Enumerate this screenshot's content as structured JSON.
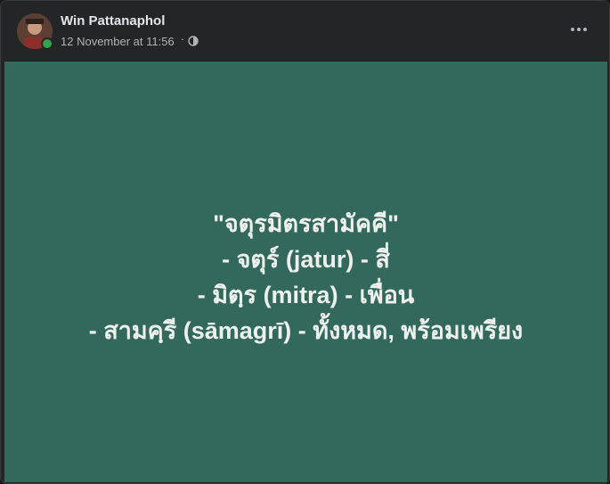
{
  "post": {
    "author": "Win Pattanaphol",
    "timestamp": "12 November at 11:56",
    "separator": "·",
    "audience_icon": "globe-icon",
    "more_icon": "more-horizontal-icon",
    "online_status_color": "#31a24c"
  },
  "content": {
    "background_color": "#33695c",
    "lines": [
      "\"จตุรมิตรสามัคคี\"",
      "- จตุร์ (jatur) - สี่",
      "- มิตฺร (mitra) - เพื่อน",
      "- สามคฺรี (sāmagrī) - ทั้งหมด, พร้อมเพรียง"
    ]
  }
}
